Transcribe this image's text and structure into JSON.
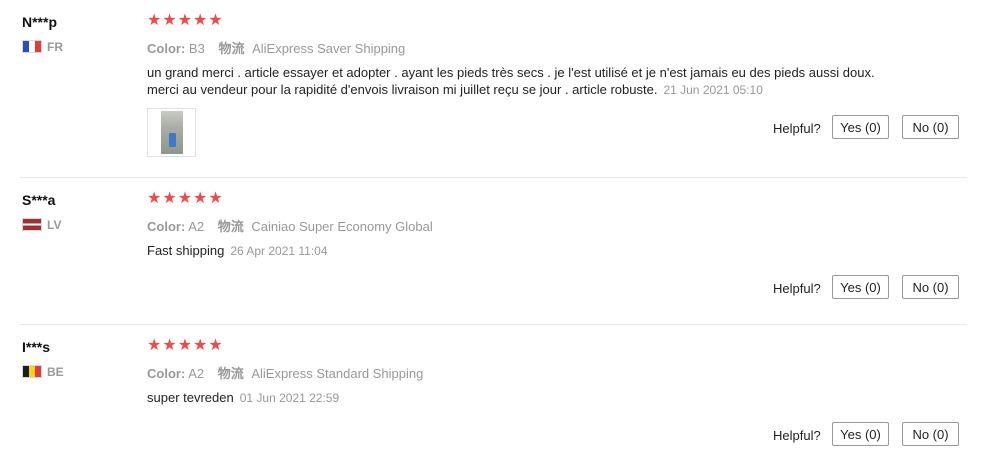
{
  "colors": {
    "star": "#f04b4b",
    "muted": "#999999",
    "divider": "#e8e8e8"
  },
  "reviews": [
    {
      "user": "N***p",
      "country": "FR",
      "flag_icon": "france-flag-icon",
      "rating": 5,
      "color_label": "Color:",
      "color_value": "B3",
      "logistics_label": "物流",
      "shipping": "AliExpress Saver Shipping",
      "text": "un grand merci . article essayer et adopter . ayant les pieds très secs . je l'est utilisé et je n'est jamais eu des pieds aussi doux. merci au vendeur pour la rapidité d'envois livraison mi juillet reçu se jour . article robuste.",
      "date": "21 Jun 2021 05:10",
      "helpful_label": "Helpful?",
      "yes_label": "Yes (0)",
      "no_label": "No (0)"
    },
    {
      "user": "S***a",
      "country": "LV",
      "flag_icon": "latvia-flag-icon",
      "rating": 5,
      "color_label": "Color:",
      "color_value": "A2",
      "logistics_label": "物流",
      "shipping": "Cainiao Super Economy Global",
      "text": "Fast shipping",
      "date": "26 Apr 2021 11:04",
      "helpful_label": "Helpful?",
      "yes_label": "Yes (0)",
      "no_label": "No (0)"
    },
    {
      "user": "I***s",
      "country": "BE",
      "flag_icon": "belgium-flag-icon",
      "rating": 5,
      "color_label": "Color:",
      "color_value": "A2",
      "logistics_label": "物流",
      "shipping": "AliExpress Standard Shipping",
      "text": "super tevreden",
      "date": "01 Jun 2021 22:59",
      "helpful_label": "Helpful?",
      "yes_label": "Yes (0)",
      "no_label": "No (0)"
    }
  ]
}
